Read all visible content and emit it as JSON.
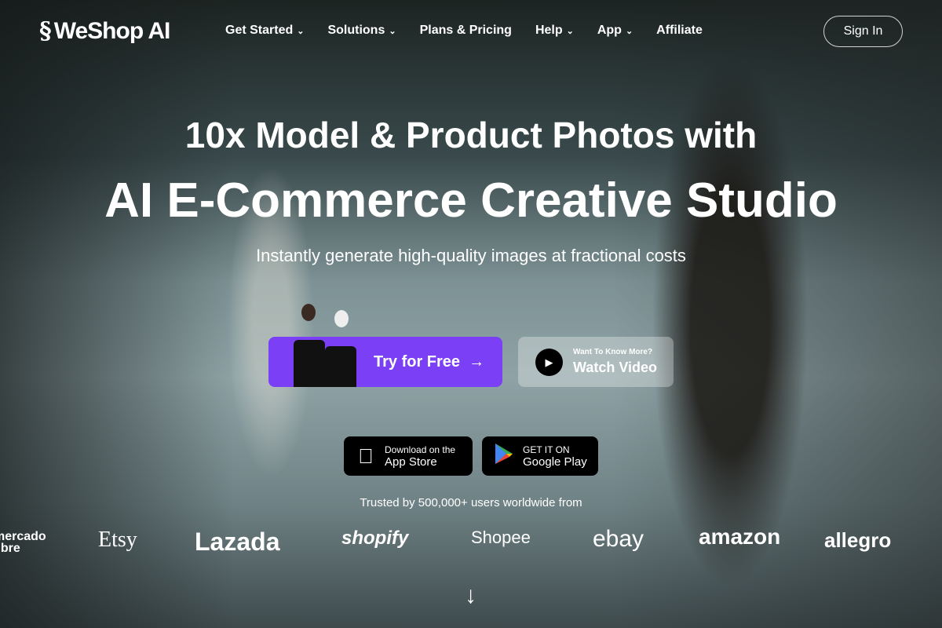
{
  "nav": {
    "brand": "WeShop AI",
    "items": [
      {
        "label": "Get Started",
        "dropdown": true
      },
      {
        "label": "Solutions",
        "dropdown": true
      },
      {
        "label": "Plans & Pricing",
        "dropdown": false
      },
      {
        "label": "Help",
        "dropdown": true
      },
      {
        "label": "App",
        "dropdown": true
      },
      {
        "label": "Affiliate",
        "dropdown": false
      }
    ],
    "sign_in": "Sign In"
  },
  "hero": {
    "title_line1": "10x Model & Product Photos with",
    "title_line2": "AI E-Commerce Creative Studio",
    "subtitle": "Instantly generate high-quality images at fractional costs"
  },
  "cta": {
    "try_label": "Try for Free",
    "watch_small": "Want To Know More?",
    "watch_label": "Watch Video",
    "accent": "#7b3ff5"
  },
  "stores": {
    "apple_line1": "Download on the",
    "apple_line2": "App Store",
    "google_line1": "GET IT ON",
    "google_line2": "Google Play"
  },
  "trusted": "Trusted by 500,000+ users worldwide from",
  "brands": [
    "mercado libre",
    "Etsy",
    "Lazada",
    "shopify",
    "Shopee",
    "ebay",
    "amazon",
    "allegro"
  ]
}
